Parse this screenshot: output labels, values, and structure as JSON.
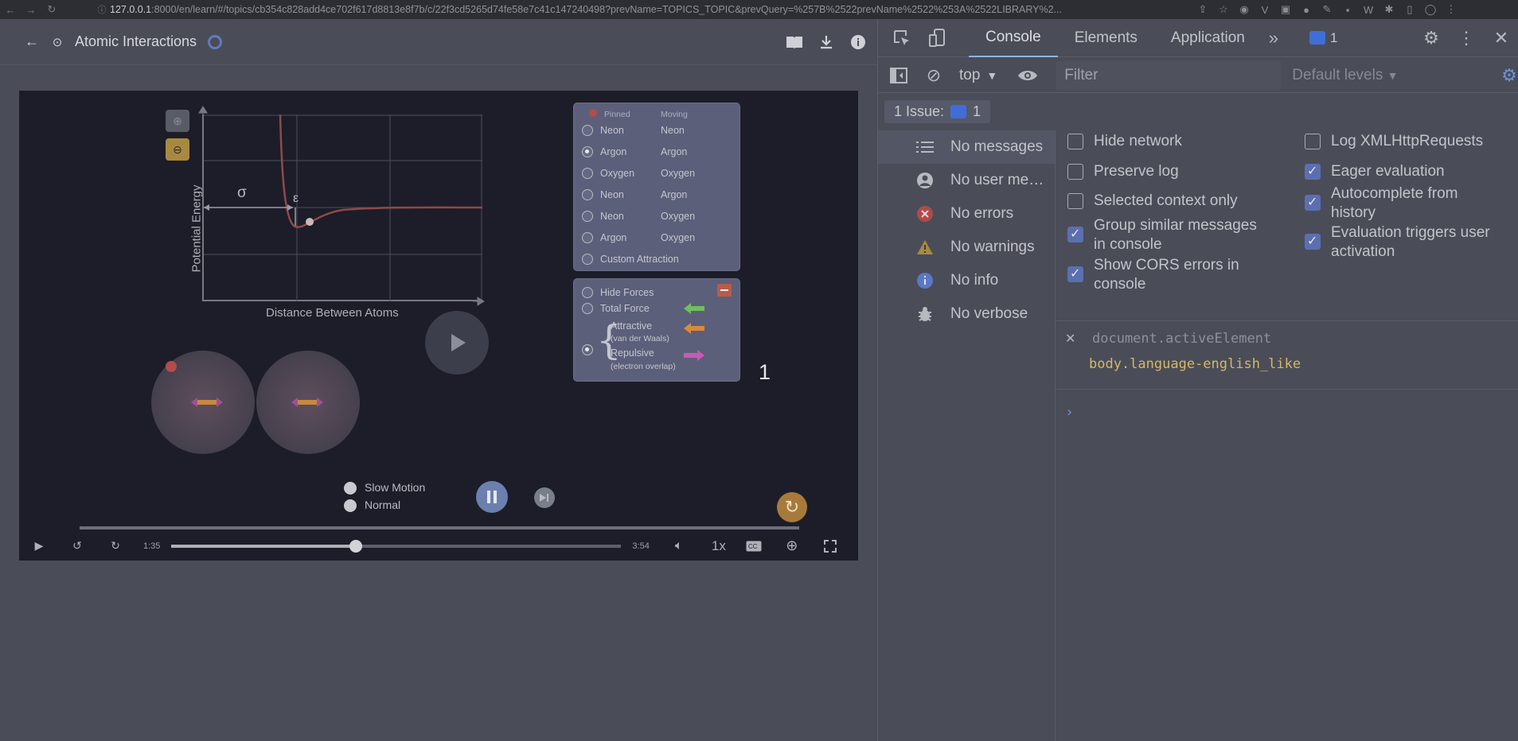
{
  "browser": {
    "url_host": "127.0.0.1",
    "url_rest": ":8000/en/learn/#/topics/cb354c828add4ce702f617d8813e8f7b/c/22f3cd5265d74fe58e7c41c147240498?prevName=TOPICS_TOPIC&prevQuery=%257B%2522prevName%2522%253A%2522LIBRARY%2..."
  },
  "app": {
    "title": "Atomic Interactions",
    "overlay_number": "1"
  },
  "sim": {
    "y_axis_label": "Potential Energy",
    "x_axis_label": "Distance Between Atoms",
    "sigma": "σ",
    "epsilon": "ε",
    "panel_headers": {
      "pinned": "Pinned",
      "moving": "Moving"
    },
    "atom_pairs": [
      {
        "pinned": "Neon",
        "moving": "Neon",
        "selected": false
      },
      {
        "pinned": "Argon",
        "moving": "Argon",
        "selected": true
      },
      {
        "pinned": "Oxygen",
        "moving": "Oxygen",
        "selected": false
      },
      {
        "pinned": "Neon",
        "moving": "Argon",
        "selected": false
      },
      {
        "pinned": "Neon",
        "moving": "Oxygen",
        "selected": false
      },
      {
        "pinned": "Argon",
        "moving": "Oxygen",
        "selected": false
      }
    ],
    "custom_attraction": "Custom Attraction",
    "forces": {
      "hide": "Hide Forces",
      "total": "Total Force",
      "attractive": "Attractive",
      "attractive_sub": "(van der Waals)",
      "repulsive": "Repulsive",
      "repulsive_sub": "(electron overlap)"
    },
    "speed": {
      "slow": "Slow Motion",
      "normal": "Normal"
    }
  },
  "player": {
    "current_time": "1:35",
    "total_time": "3:54",
    "progress": 0.41,
    "rate": "1x"
  },
  "devtools": {
    "tabs": [
      "Console",
      "Elements",
      "Application"
    ],
    "active_tab": "Console",
    "issues_badge": "1",
    "context": "top",
    "filter_placeholder": "Filter",
    "levels": "Default levels",
    "issue_bar_label": "1 Issue:",
    "issue_bar_count": "1",
    "sidebar": [
      {
        "label": "No messages",
        "icon": "list-icon"
      },
      {
        "label": "No user me…",
        "icon": "user-icon"
      },
      {
        "label": "No errors",
        "icon": "error-icon"
      },
      {
        "label": "No warnings",
        "icon": "warning-icon"
      },
      {
        "label": "No info",
        "icon": "info-icon"
      },
      {
        "label": "No verbose",
        "icon": "bug-icon"
      }
    ],
    "options_left": [
      {
        "line1": "Hide network",
        "line2": "",
        "checked": false
      },
      {
        "line1": "Preserve log",
        "line2": "",
        "checked": false
      },
      {
        "line1": "Selected context only",
        "line2": "",
        "checked": false
      },
      {
        "line1": "Group similar messages",
        "line2": "in console",
        "checked": true
      },
      {
        "line1": "Show CORS errors in",
        "line2": "console",
        "checked": true
      }
    ],
    "options_right": [
      {
        "line1": "Log XMLHttpRequests",
        "line2": "",
        "checked": false
      },
      {
        "line1": "Eager evaluation",
        "line2": "",
        "checked": true
      },
      {
        "line1": "Autocomplete from",
        "line2": "history",
        "checked": true
      },
      {
        "line1": "Evaluation triggers user",
        "line2": "activation",
        "checked": true
      }
    ],
    "expression": "document.activeElement",
    "result": "body.language-english_like"
  },
  "colors": {
    "accent": "#8ab4f8",
    "attractive_arrow": "#d98a3c",
    "repulsive_arrow": "#c65bb5",
    "total_arrow": "#6fbf5a"
  }
}
